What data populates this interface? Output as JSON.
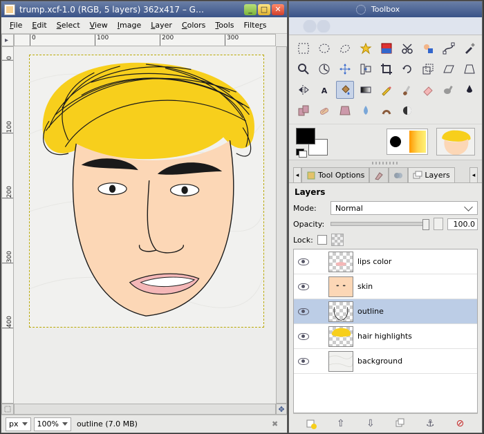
{
  "image_window": {
    "title": "trump.xcf-1.0 (RGB, 5 layers) 362x417 – G…",
    "menu": [
      "File",
      "Edit",
      "Select",
      "View",
      "Image",
      "Layer",
      "Colors",
      "Tools",
      "Filters"
    ],
    "ruler_h": [
      0,
      100,
      200,
      300
    ],
    "ruler_v": [
      0,
      100,
      200,
      300,
      400
    ],
    "status": {
      "unit": "px",
      "zoom": "100%",
      "message": "outline (7.0 MB)"
    }
  },
  "toolbox": {
    "title": "Toolbox",
    "tools": [
      {
        "name": "rect-select-icon"
      },
      {
        "name": "ellipse-select-icon"
      },
      {
        "name": "free-select-icon"
      },
      {
        "name": "fuzzy-select-icon"
      },
      {
        "name": "color-select-icon"
      },
      {
        "name": "scissors-icon"
      },
      {
        "name": "foreground-select-icon"
      },
      {
        "name": "paths-icon"
      },
      {
        "name": "color-picker-icon"
      },
      {
        "name": "zoom-icon"
      },
      {
        "name": "measure-icon"
      },
      {
        "name": "move-icon"
      },
      {
        "name": "align-icon"
      },
      {
        "name": "crop-icon"
      },
      {
        "name": "rotate-icon"
      },
      {
        "name": "scale-icon"
      },
      {
        "name": "shear-icon"
      },
      {
        "name": "perspective-icon"
      },
      {
        "name": "flip-icon"
      },
      {
        "name": "text-icon"
      },
      {
        "name": "bucket-fill-icon",
        "active": true
      },
      {
        "name": "blend-icon"
      },
      {
        "name": "pencil-icon"
      },
      {
        "name": "paintbrush-icon"
      },
      {
        "name": "eraser-icon"
      },
      {
        "name": "airbrush-icon"
      },
      {
        "name": "ink-icon"
      },
      {
        "name": "clone-icon"
      },
      {
        "name": "heal-icon"
      },
      {
        "name": "perspective-clone-icon"
      },
      {
        "name": "blur-icon"
      },
      {
        "name": "smudge-icon"
      },
      {
        "name": "dodge-burn-icon"
      }
    ],
    "tabs": {
      "tool_options": "Tool Options",
      "layers": "Layers"
    },
    "layers_panel": {
      "heading": "Layers",
      "mode_label": "Mode:",
      "mode_value": "Normal",
      "opacity_label": "Opacity:",
      "opacity_value": "100.0",
      "lock_label": "Lock:",
      "layers": [
        {
          "name": "lips color",
          "visible": true,
          "selected": false,
          "thumb": "lips"
        },
        {
          "name": "skin",
          "visible": true,
          "selected": false,
          "thumb": "skin"
        },
        {
          "name": "outline",
          "visible": true,
          "selected": true,
          "thumb": "outline"
        },
        {
          "name": "hair highlights",
          "visible": true,
          "selected": false,
          "thumb": "hair"
        },
        {
          "name": "background",
          "visible": true,
          "selected": false,
          "thumb": "bg"
        }
      ]
    }
  }
}
